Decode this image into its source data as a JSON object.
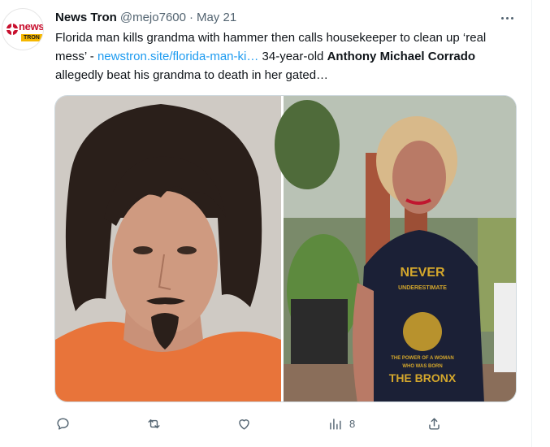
{
  "tweet": {
    "author_name": "News Tron",
    "handle": "@mejo7600",
    "separator": "·",
    "date": "May 21",
    "avatar": {
      "brand_word": "news",
      "brand_sub": "TRON"
    },
    "text_part1": "Florida man kills grandma with hammer then calls housekeeper to clean up ‘real mess’ - ",
    "link_text": "newstron.site/florida-man-ki…",
    "text_part2": " 34-year-old ",
    "bold_name": "Anthony Michael Corrado",
    "text_part3": " allegedly beat his grandma to death in her gated…",
    "media": {
      "shirt_text_top": "NEVER",
      "shirt_text_small": "UNDERESTIMATE",
      "shirt_text_mid": "THE POWER OF A WOMAN",
      "shirt_text_small2": "WHO WAS BORN",
      "shirt_text_bottom": "THE BRONX"
    },
    "views_count": "8"
  },
  "colors": {
    "link": "#1d9bf0",
    "muted": "#536471",
    "border": "#cfd9de"
  },
  "icons": [
    "reply-icon",
    "retweet-icon",
    "like-icon",
    "views-icon",
    "share-icon",
    "more-icon"
  ]
}
